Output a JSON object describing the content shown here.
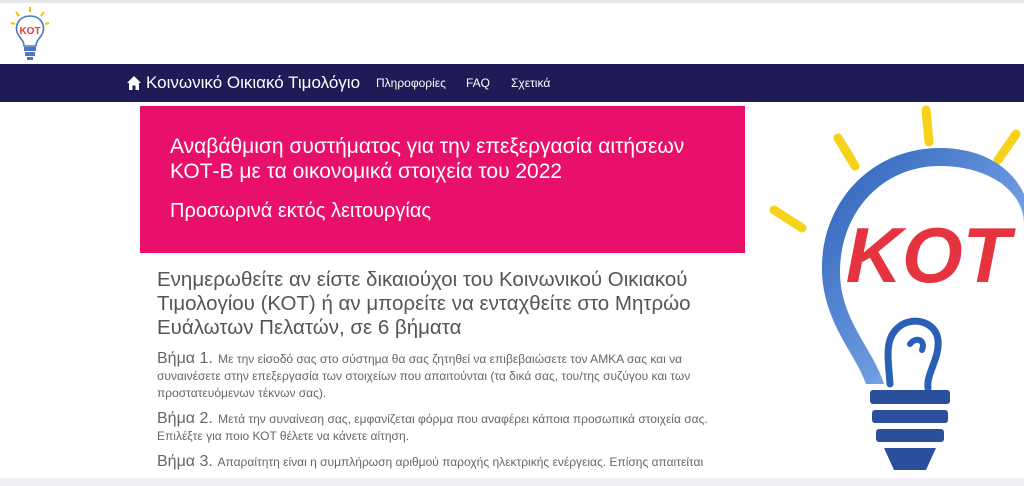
{
  "logo": {
    "icon": "kot-bulb-logo-icon",
    "text": "KOT"
  },
  "navbar": {
    "brand_label": "Κοινωνικό Οικιακό Τιμολόγιο",
    "links": [
      {
        "label": "Πληροφορίες"
      },
      {
        "label": "FAQ"
      },
      {
        "label": "Σχετικά"
      }
    ],
    "color": "#1f1b57"
  },
  "banner": {
    "title": "Αναβάθμιση συστήματος για την επεξεργασία αιτήσεων ΚΟΤ-Β με τα οικονομικά στοιχεία του 2022",
    "subtitle": "Προσωρινά εκτός λειτουργίας",
    "color": "#e8106a"
  },
  "main": {
    "heading": "Ενημερωθείτε αν είστε δικαιούχοι του Κοινωνικού Οικιακού Τιμολογίου (ΚΟΤ) ή αν μπορείτε να ενταχθείτε στο Μητρώο Ευάλωτων Πελατών, σε 6 βήματα",
    "steps": [
      {
        "label": "Βήμα 1.",
        "text": "Με την είσοδό σας στο σύστημα θα σας ζητηθεί να επιβεβαιώσετε τον ΑΜΚΑ σας και να συναινέσετε στην επεξεργασία των στοιχείων που απαιτούνται (τα δικά σας, του/της συζύγου και των προστατευόμενων τέκνων σας)."
      },
      {
        "label": "Βήμα 2.",
        "text": "Μετά την συναίνεση σας, εμφανίζεται φόρμα που αναφέρει κάποια προσωπικά στοιχεία σας. Επιλέξτε για ποιο ΚΟΤ θέλετε να κάνετε αίτηση."
      },
      {
        "label": "Βήμα 3.",
        "text": "Απαραίτητη είναι η συμπλήρωση αριθμού παροχής ηλεκτρικής ενέργειας. Επίσης απαιτείται"
      }
    ]
  },
  "illustration": {
    "icon": "kot-lightbulb-icon",
    "text": "KOT"
  }
}
